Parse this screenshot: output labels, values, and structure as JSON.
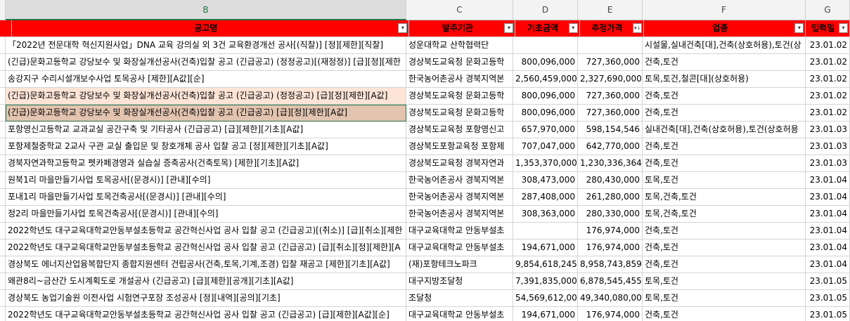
{
  "columns": [
    "B",
    "C",
    "D",
    "E",
    "F",
    "G"
  ],
  "header": {
    "b": "공고명",
    "c": "발주기관",
    "d": "기초금액",
    "e": "추정가격",
    "f": "업종",
    "g": "입력일",
    "filter_icon": "▾",
    "sort_filter_icon": "▾↓"
  },
  "rows": [
    {
      "b": "「2022년 전문대학 혁신지원사업」DNA 교육 강의실 외 3건 교육환경개선 공사[(직찰)] [정][제한][직찰]",
      "c": "성운대학교 산학협력단",
      "d": "",
      "e": "",
      "f": "시설물,실내건축[대],건축(상호허용),토건(상",
      "g": "23.01.02"
    },
    {
      "b": "(긴급)문화고등학교 강당보수 및 화장실개선공사(건축)입찰 공고 (긴급공고) (정정공고)[(재정정)] [급][정][제한",
      "c": "경상북도교육청 문화고등학",
      "d": "800,096,000",
      "e": "727,360,000",
      "f": "건축,토건",
      "g": "23.01.02"
    },
    {
      "b": "송강지구 수리시설개보수사업 토목공사 [제한][A값][순]",
      "c": "한국농어촌공사 경북지역본",
      "d": "2,560,459,000",
      "e": "2,327,690,000",
      "f": "토목,토건,철콘[대](상호허용)",
      "g": "23.01.02"
    },
    {
      "b": "(긴급)문화고등학교 강당보수 및 화장실개선공사(건축)입찰 공고 (긴급공고) (정정공고) [급][정][제한][A값]",
      "c": "경상북도교육청 문화고등학",
      "d": "800,096,000",
      "e": "727,360,000",
      "f": "건축,토건",
      "g": "23.01.02"
    },
    {
      "b": "(긴급)문화고등학교 강당보수 및 화장실개선공사(건축)입찰 공고 (긴급공고) [급][정][제한][A값]",
      "c": "경상북도교육청 문화고등학",
      "d": "800,096,000",
      "e": "727,360,000",
      "f": "건축,토건",
      "g": "23.01.02"
    },
    {
      "b": "포항영신고등학교 교과교실 공간구축 및 기타공사 (긴급공고) [급][제한][기초][A값]",
      "c": "경상북도교육청 포항영신고",
      "d": "657,970,000",
      "e": "598,154,546",
      "f": "실내건축[대],건축(상호허용),토건(상호허용",
      "g": "23.01.03"
    },
    {
      "b": "포항제철중학교 2교사 구관 교실 출입문 및 창호개체 공사 입찰 공고 [정][제한][기초][A값]",
      "c": "경상북도포항교육청 포항제",
      "d": "707,047,000",
      "e": "642,770,000",
      "f": "건축,토건",
      "g": "23.01.03"
    },
    {
      "b": "경북자연과학고등학교 펫카페경영과 실습실 증축공사(건축토목) [제한][기초][A값]",
      "c": "경상북도교육청 경북자연과",
      "d": "1,353,370,000",
      "e": "1,230,336,364",
      "f": "건축,토건",
      "g": "23.01.03"
    },
    {
      "b": "원북1리 마을만들기사업 토목공사[(문경시)] [관내][수의]",
      "c": "한국농어촌공사 경북지역본",
      "d": "308,473,000",
      "e": "280,430,000",
      "f": "토목,토건",
      "g": "23.01.04"
    },
    {
      "b": "포내1리 마을만들기사업 토목건축공사[(문경시)] [관내][수의]",
      "c": "한국농어촌공사 경북지역본",
      "d": "287,408,000",
      "e": "261,280,000",
      "f": "토목,건축,토건",
      "g": "23.01.04"
    },
    {
      "b": "정2리 마을만들기사업 토목건축공사[(문경시)] [관내][수의]",
      "c": "한국농어촌공사 경북지역본",
      "d": "308,363,000",
      "e": "280,330,000",
      "f": "토목,건축,토건",
      "g": "23.01.04"
    },
    {
      "b": "2022학년도 대구교육대학교안동부설초등학교 공간혁신사업 공사 입찰 공고 (긴급공고)[(취소)] [급][취소][제한",
      "c": "대구교육대학교 안동부설초",
      "d": "",
      "e": "176,974,000",
      "f": "건축,토건",
      "g": "23.01.04"
    },
    {
      "b": "2022학년도 대구교육대학교안동부설초등학교 공간혁신사업 공사 입찰 공고 (긴급공고) [급][취소][정][제한][A",
      "c": "대구교육대학교 안동부설초",
      "d": "194,671,000",
      "e": "176,974,000",
      "f": "건축,토건",
      "g": "23.01.04"
    },
    {
      "b": "경상북도 에너지산업융복합단지 종합지원센터 건립공사(건축,토목,기계,조경) 입찰 재공고 [제한][기초][A값]",
      "c": "(재)포항테크노파크",
      "d": "9,854,618,245",
      "e": "8,958,743,859",
      "f": "건축,토건",
      "g": "23.01.04"
    },
    {
      "b": "왜관8리~금산간 도시계획도로 개설공사 (긴급공고) [급][제한][공개][기초][A값]",
      "c": "대구지방조달청",
      "d": "7,391,835,000",
      "e": "6,878,545,455",
      "f": "토목,토건",
      "g": "23.01.05"
    },
    {
      "b": "경상북도 농업기술원 이전사업 시험연구포장 조성공사 [정][내역][공의][기초]",
      "c": "조달청",
      "d": "54,569,612,000",
      "e": "49,340,080,000",
      "f": "토목,토건",
      "g": "23.01.05"
    },
    {
      "b": "2022학년도 대구교육대학교안동부설초등학교 공간혁신사업 공사 입찰 공고 (긴급공고) [급][제한][A값][순]",
      "c": "대구교육대학교 안동부설초",
      "d": "194,671,000",
      "e": "176,974,000",
      "f": "건축,토건",
      "g": "23.01.05"
    }
  ]
}
